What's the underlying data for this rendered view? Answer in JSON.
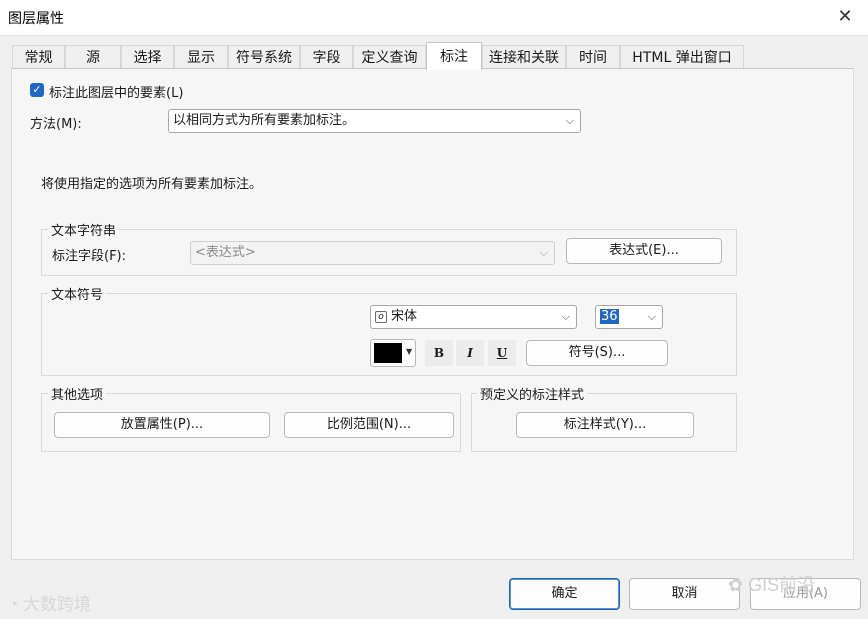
{
  "window": {
    "title": "图层属性",
    "close_glyph": "✕"
  },
  "tabs": [
    {
      "label": "常规"
    },
    {
      "label": "源"
    },
    {
      "label": "选择"
    },
    {
      "label": "显示"
    },
    {
      "label": "符号系统"
    },
    {
      "label": "字段"
    },
    {
      "label": "定义查询"
    },
    {
      "label": "标注",
      "active": true
    },
    {
      "label": "连接和关联"
    },
    {
      "label": "时间"
    },
    {
      "label": "HTML 弹出窗口"
    }
  ],
  "label_tab": {
    "checkbox_label": "标注此图层中的要素(L)",
    "checkbox_checked": true,
    "method_label": "方法(M):",
    "method_value": "以相同方式为所有要素加标注。",
    "info_text": "将使用指定的选项为所有要素加标注。",
    "text_string": {
      "group_title": "文本字符串",
      "field_label": "标注字段(F):",
      "field_value": "<表达式>",
      "expression_button": "表达式(E)..."
    },
    "text_symbol": {
      "group_title": "文本符号",
      "font_value": "宋体",
      "font_icon": "opentype-font-icon",
      "size_value": "36",
      "color": "#000000",
      "bold_label": "B",
      "italic_label": "I",
      "underline_label": "U",
      "symbol_button": "符号(S)..."
    },
    "other_options": {
      "group_title": "其他选项",
      "placement_button": "放置属性(P)...",
      "scale_button": "比例范围(N)..."
    },
    "predefined": {
      "group_title": "预定义的标注样式",
      "style_button": "标注样式(Y)..."
    }
  },
  "footer": {
    "ok_label": "确定",
    "cancel_label": "取消",
    "apply_label": "应用(A)"
  },
  "watermarks": {
    "left": "大数跨境",
    "right": "GIS前沿"
  },
  "colors": {
    "accent": "#2168c4",
    "primary_border": "#1f63b8"
  }
}
